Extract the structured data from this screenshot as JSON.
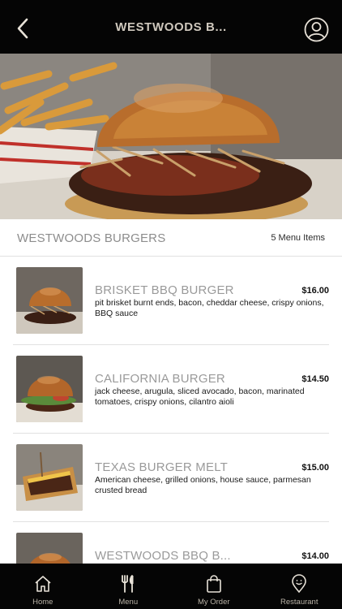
{
  "header": {
    "title": "WESTWOODS B...",
    "back_icon": "chevron-left-icon",
    "profile_icon": "user-circle-icon"
  },
  "section": {
    "title": "WESTWOODS BURGERS",
    "count": "5 Menu Items"
  },
  "items": [
    {
      "name": "BRISKET BBQ BURGER",
      "price": "$16.00",
      "description": "pit brisket burnt ends, bacon, cheddar cheese, crispy onions, BBQ sauce"
    },
    {
      "name": "CALIFORNIA BURGER",
      "price": "$14.50",
      "description": "jack cheese, arugula, sliced avocado, bacon, marinated tomatoes, crispy onions, cilantro aioli"
    },
    {
      "name": "TEXAS BURGER MELT",
      "price": "$15.00",
      "description": "American cheese, grilled onions, house sauce, parmesan crusted bread"
    },
    {
      "name": "WESTWOODS BBQ B...",
      "price": "$14.00",
      "description": ""
    }
  ],
  "tabs": [
    {
      "label": "Home",
      "icon": "home-icon"
    },
    {
      "label": "Menu",
      "icon": "fork-knife-icon"
    },
    {
      "label": "My Order",
      "icon": "shopping-bag-icon"
    },
    {
      "label": "Restaurant",
      "icon": "location-pin-icon"
    }
  ],
  "colors": {
    "bar_background": "#050505",
    "accent_text": "#cfc8bd",
    "muted_text": "#8d8d8d"
  }
}
